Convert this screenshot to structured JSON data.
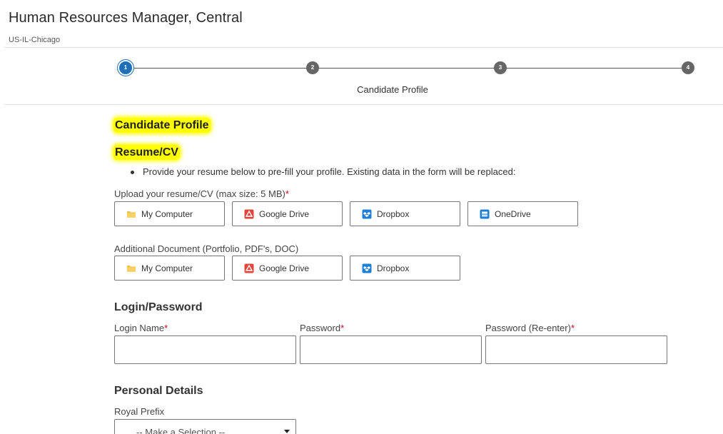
{
  "header": {
    "job_title": "Human Resources Manager, Central",
    "location": "US-IL-Chicago"
  },
  "stepper": {
    "steps": [
      "1",
      "2",
      "3",
      "4"
    ],
    "active_step": 1,
    "current_label": "Candidate Profile"
  },
  "main": {
    "page_heading": "Candidate Profile",
    "resume_section": {
      "heading": "Resume/CV",
      "bullet": "Provide your resume below to pre-fill your profile. Existing data in the form will be replaced:",
      "upload_label": "Upload your resume/CV (max size: 5 MB)",
      "required_mark": "*",
      "upload_buttons": [
        {
          "label": "My Computer",
          "icon": "folder-icon"
        },
        {
          "label": "Google Drive",
          "icon": "google-drive-icon"
        },
        {
          "label": "Dropbox",
          "icon": "dropbox-icon"
        },
        {
          "label": "OneDrive",
          "icon": "onedrive-icon"
        }
      ],
      "additional_label": "Additional Document (Portfolio, PDF's, DOC)",
      "additional_buttons": [
        {
          "label": "My Computer",
          "icon": "folder-icon"
        },
        {
          "label": "Google Drive",
          "icon": "google-drive-icon"
        },
        {
          "label": "Dropbox",
          "icon": "dropbox-icon"
        }
      ]
    },
    "login_section": {
      "heading": "Login/Password",
      "fields": [
        {
          "label": "Login Name",
          "value": ""
        },
        {
          "label": "Password",
          "value": ""
        },
        {
          "label": "Password (Re-enter)",
          "value": ""
        }
      ],
      "required_mark": "*"
    },
    "personal_section": {
      "heading": "Personal Details",
      "royal_prefix_label": "Royal Prefix",
      "royal_prefix_value": "-- Make a Selection --"
    }
  },
  "colors": {
    "highlight": "#ffff00",
    "active_step": "#1f6fb8",
    "inactive_step": "#666666",
    "required": "#d0021b",
    "folder": "#f5c242",
    "google_drive": "#e0443a",
    "dropbox": "#1f7fd6",
    "onedrive": "#1f7fd6"
  }
}
